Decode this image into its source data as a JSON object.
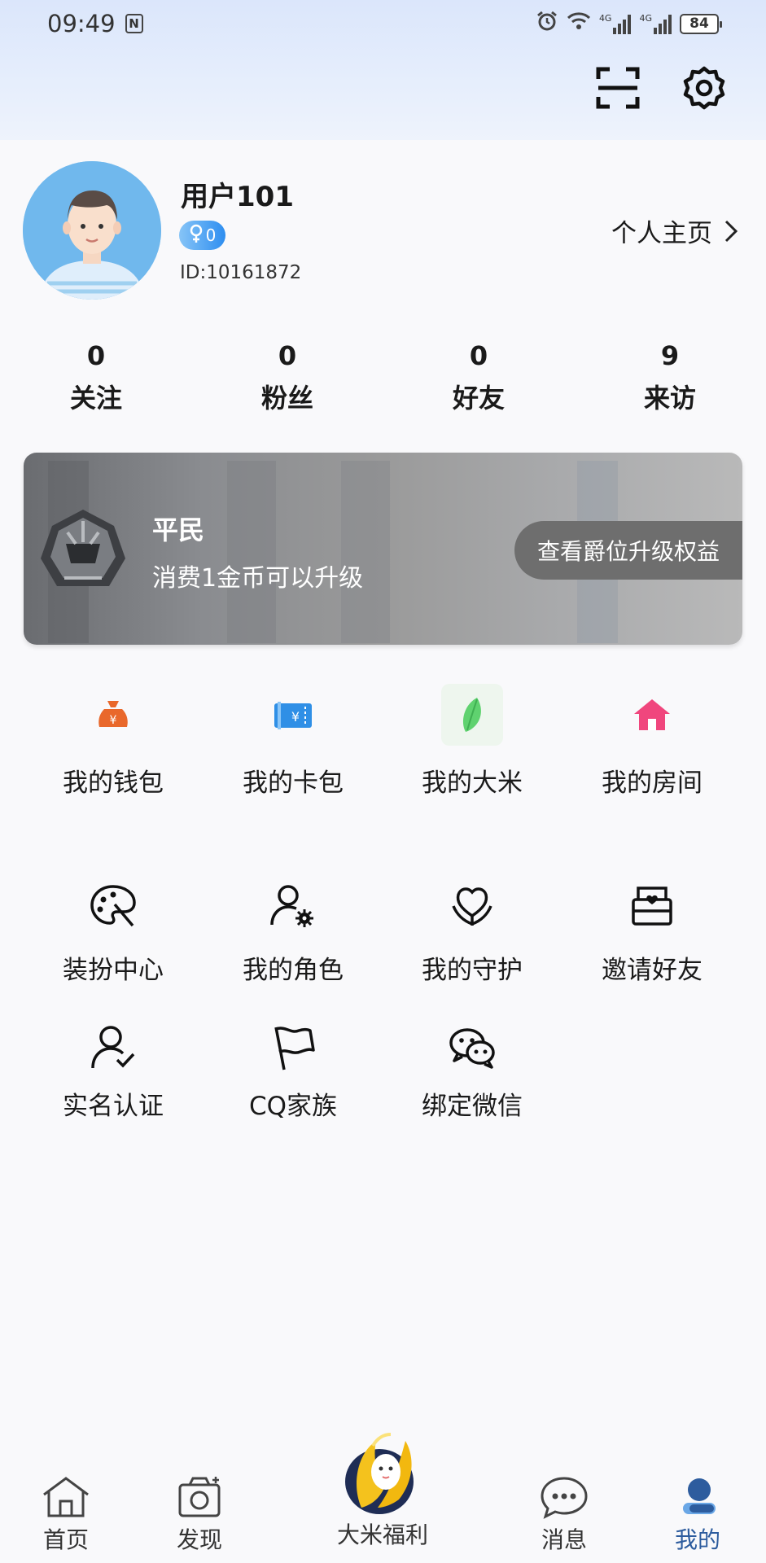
{
  "status_bar": {
    "time": "09:49",
    "nfc": "N",
    "battery": "84",
    "net1": "4G",
    "net2": "4G"
  },
  "top_actions": {
    "scan_icon": "scan-icon",
    "settings_icon": "gear-icon"
  },
  "profile": {
    "username": "用户101",
    "gender_level": "0",
    "user_id": "ID:10161872",
    "homepage_label": "个人主页"
  },
  "stats": [
    {
      "value": "0",
      "label": "关注"
    },
    {
      "value": "0",
      "label": "粉丝"
    },
    {
      "value": "0",
      "label": "好友"
    },
    {
      "value": "9",
      "label": "来访"
    }
  ],
  "rank": {
    "title": "平民",
    "description": "消费1金币可以升级",
    "button": "查看爵位升级权益"
  },
  "menu_row1": [
    {
      "label": "我的钱包",
      "icon": "wallet-icon",
      "color": "#e9682b"
    },
    {
      "label": "我的卡包",
      "icon": "card-icon",
      "color": "#2f8fe6"
    },
    {
      "label": "我的大米",
      "icon": "rice-icon",
      "color": "#5fd26f"
    },
    {
      "label": "我的房间",
      "icon": "room-icon",
      "color": "#f0467d"
    }
  ],
  "menu_row2": [
    {
      "label": "装扮中心",
      "icon": "palette-icon"
    },
    {
      "label": "我的角色",
      "icon": "user-settings-icon"
    },
    {
      "label": "我的守护",
      "icon": "guard-heart-icon"
    },
    {
      "label": "邀请好友",
      "icon": "invite-envelope-icon"
    }
  ],
  "menu_row3": [
    {
      "label": "实名认证",
      "icon": "verify-user-icon"
    },
    {
      "label": "CQ家族",
      "icon": "flag-icon"
    },
    {
      "label": "绑定微信",
      "icon": "wechat-icon"
    }
  ],
  "nav": {
    "home": "首页",
    "discover": "发现",
    "rice": "大米福利",
    "messages": "消息",
    "mine": "我的"
  },
  "colors": {
    "accent": "#2d5c9e",
    "page_bg": "#f9f9fb"
  }
}
